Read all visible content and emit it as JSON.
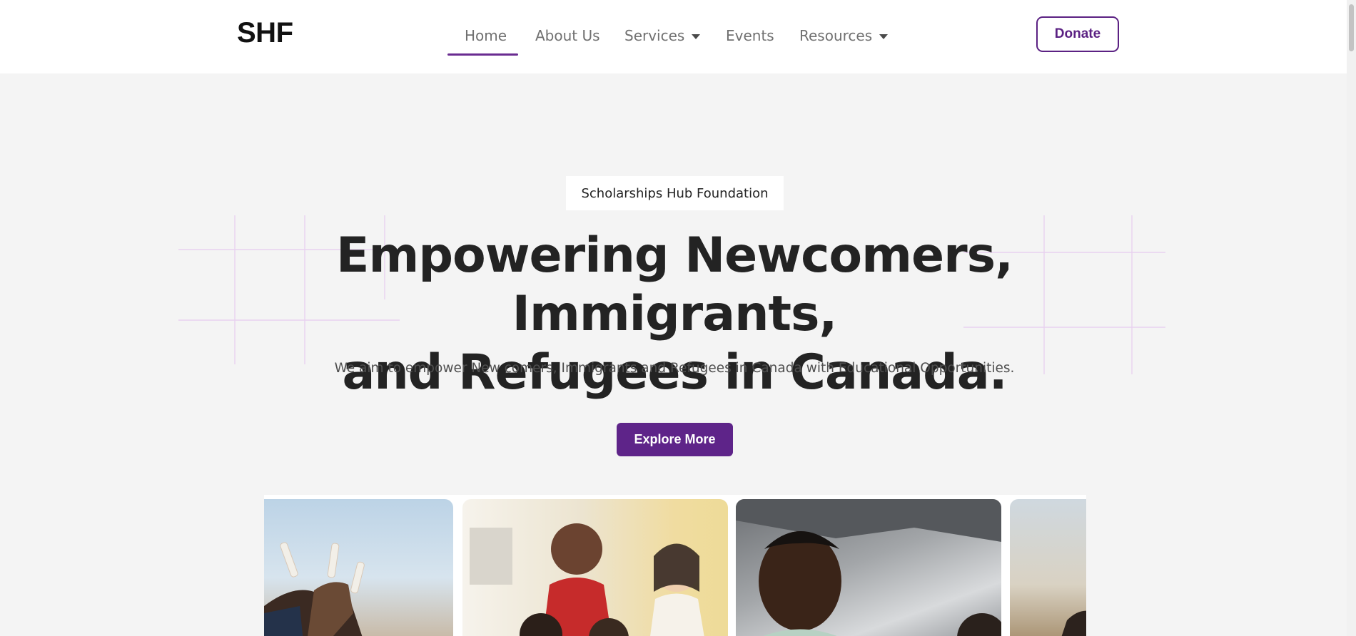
{
  "header": {
    "logo": "SHF",
    "nav": [
      {
        "label": "Home",
        "active": true,
        "dropdown": false
      },
      {
        "label": "About Us",
        "active": false,
        "dropdown": false
      },
      {
        "label": "Services",
        "active": false,
        "dropdown": true
      },
      {
        "label": "Events",
        "active": false,
        "dropdown": false
      },
      {
        "label": "Resources",
        "active": false,
        "dropdown": true
      }
    ],
    "donate_label": "Donate"
  },
  "hero": {
    "badge": "Scholarships Hub Foundation",
    "headline_line1": "Empowering Newcomers, Immigrants,",
    "headline_line2": "and Refugees in Canada.",
    "subtext": "We aim to empower New comers, Immigrants and Refugees in Canada with Educational Opportunities.",
    "cta_label": "Explore More"
  },
  "gallery": {
    "photos": [
      {
        "icon": "graduates-raising-diplomas-photo"
      },
      {
        "icon": "smiling-children-group-photo"
      },
      {
        "icon": "smiling-woman-outdoors-photo"
      },
      {
        "icon": "partial-photo"
      }
    ]
  },
  "colors": {
    "accent": "#5e2489",
    "nav_underline": "#6a2c91",
    "page_background": "#f4f4f4",
    "header_background": "#ffffff"
  }
}
